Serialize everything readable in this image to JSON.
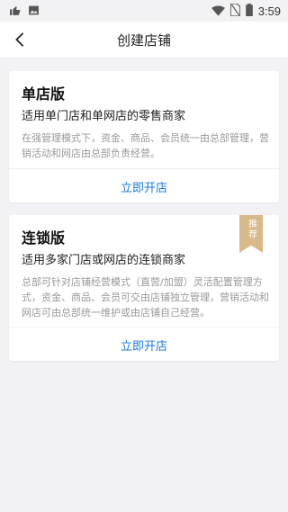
{
  "status_bar": {
    "time": "3:59",
    "icons": [
      "thumbs-up-icon",
      "image-icon",
      "wifi-icon",
      "no-sim-icon",
      "battery-icon"
    ]
  },
  "header": {
    "title": "创建店铺",
    "back_icon": "chevron-left-icon"
  },
  "cards": [
    {
      "title": "单店版",
      "subtitle": "适用单门店和单网店的零售商家",
      "description": "在强管理模式下，资金、商品、会员统一由总部管理，营销活动和网店由总部负责经营。",
      "action_label": "立即开店"
    },
    {
      "title": "连锁版",
      "subtitle": "适用多家门店或网店的连锁商家",
      "description": "总部可针对店铺经营模式（直营/加盟）灵活配置管理方式，资金、商品、会员可交由店铺独立管理，营销活动和网店可由总部统一维护或由店铺自己经营。",
      "action_label": "立即开店",
      "badge": "推荐"
    }
  ],
  "colors": {
    "accent": "#1a7be0",
    "badge": "#d9b88a",
    "background": "#f2f2f4"
  }
}
